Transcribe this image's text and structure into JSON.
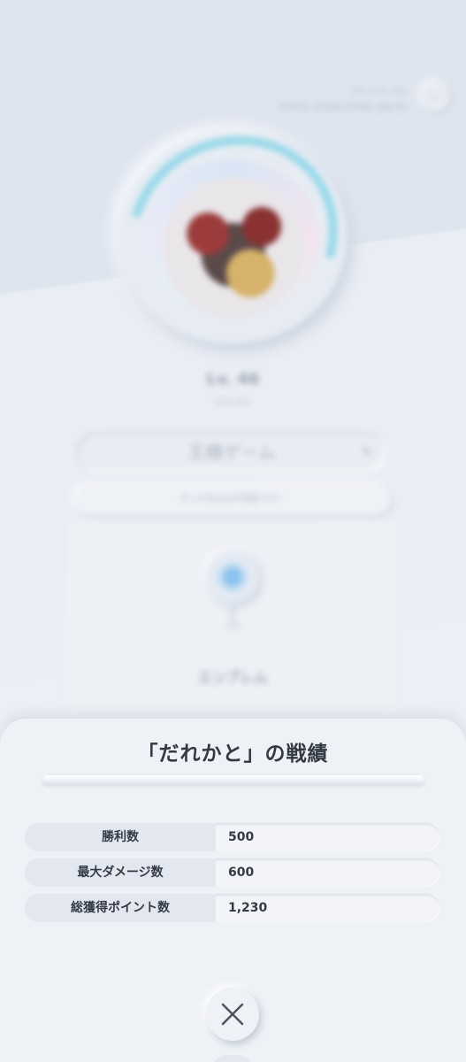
{
  "profile": {
    "player_id_label": "プレイヤーID",
    "player_id": "0743-3339-9742-6479",
    "next_icon": "chevron-right-icon",
    "level": "Lv. 46",
    "exp": "205/2,805",
    "player_name": "王様ゲーム",
    "message": "デッキ作るのが得意です！",
    "emblem_label": "146",
    "emblem_section_title": "エンブレム"
  },
  "modal": {
    "title": "「だれかと」の戦績",
    "stats": [
      {
        "label": "勝利数",
        "value": "500"
      },
      {
        "label": "最大ダメージ数",
        "value": "600"
      },
      {
        "label": "総獲得ポイント数",
        "value": "1,230"
      }
    ],
    "close_icon": "close-icon"
  },
  "colors": {
    "accent": "#7fd3e6",
    "text_dark": "#343b46",
    "panel": "#eef1f6"
  }
}
